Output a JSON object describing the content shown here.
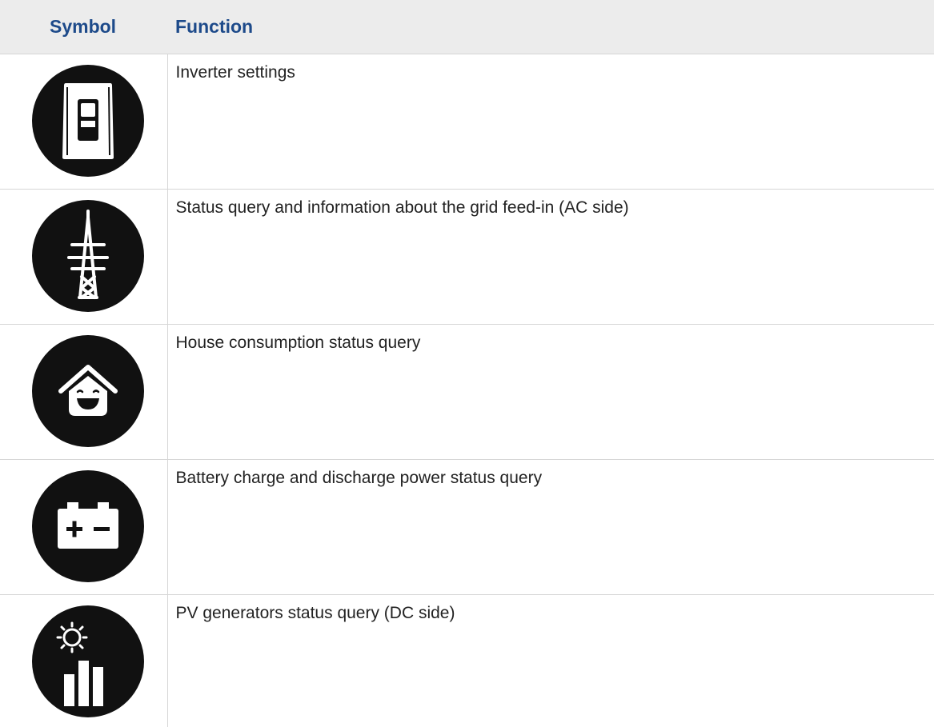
{
  "table": {
    "headers": {
      "symbol": "Symbol",
      "function": "Function"
    },
    "rows": [
      {
        "icon": "inverter-icon",
        "function": "Inverter settings"
      },
      {
        "icon": "power-pylon-icon",
        "function": "Status query and information about the grid feed-in (AC side)"
      },
      {
        "icon": "house-smile-icon",
        "function": "House consumption status query"
      },
      {
        "icon": "battery-icon",
        "function": "Battery charge and discharge power status query"
      },
      {
        "icon": "pv-generator-icon",
        "function": "PV generators status query (DC side)"
      }
    ]
  },
  "colors": {
    "header_text": "#1d4a8a",
    "header_background": "#ececec",
    "icon_circle": "#111111",
    "icon_glyph": "#ffffff"
  }
}
